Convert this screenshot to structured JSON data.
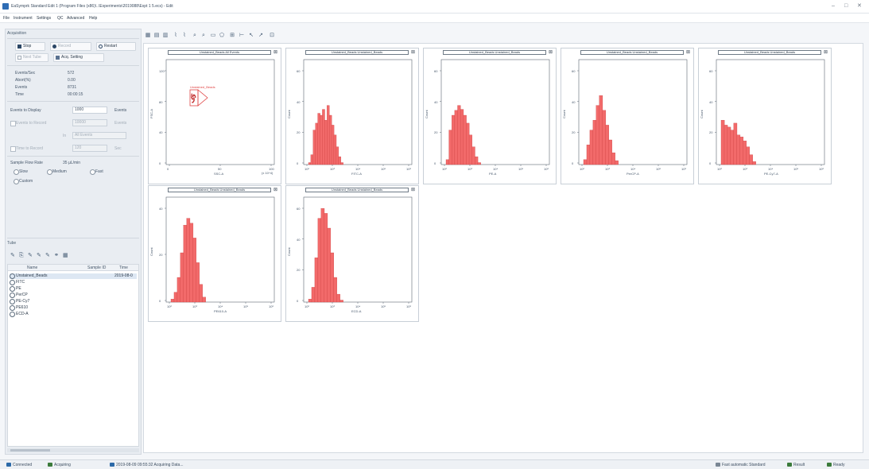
{
  "window": {
    "title": "EaSymprk Standard Edit 1 (Program Files (x86)\\..\\Experiments\\2019088\\Expt 1 5.ecs) - Edit",
    "controls": [
      "–",
      "□",
      "✕"
    ]
  },
  "menu": [
    "File",
    "Instrument",
    "Settings",
    "QC",
    "Advanced",
    "Help"
  ],
  "acquisition": {
    "header": "Acquisition",
    "buttons": {
      "stop": "Stop",
      "record": "Record",
      "restart": "Restart",
      "next_tube": "Next Tube",
      "acq_setting": "Acq. Setting"
    },
    "stats": [
      {
        "label": "Events/Sec",
        "value": "572"
      },
      {
        "label": "Abort(%)",
        "value": "0.00"
      },
      {
        "label": "Events",
        "value": "8731"
      },
      {
        "label": "Time",
        "value": "00:00:15"
      }
    ],
    "events_to_display": {
      "label": "Events to Display",
      "value": "1000",
      "unit": "Events"
    },
    "stop_condition_events": {
      "label": "Events to Record",
      "value": "10000",
      "unit": "Events"
    },
    "stop_condition_gate": {
      "label": "In",
      "value": "All Events"
    },
    "stop_condition_time": {
      "label": "Time to Record",
      "value": "120",
      "unit": "Sec"
    },
    "flow_rate": {
      "label": "Sample Flow Rate",
      "value": "35 µL/min",
      "options": [
        "Slow",
        "Medium",
        "Fast",
        "Custom"
      ]
    }
  },
  "tube": {
    "header": "Tube",
    "columns": [
      "Name",
      "Sample ID",
      "Time"
    ],
    "rows": [
      {
        "name": "Unstained_Beads",
        "time": "2019-08-0"
      },
      {
        "name": "FITC",
        "time": ""
      },
      {
        "name": "PE",
        "time": ""
      },
      {
        "name": "PerCP",
        "time": ""
      },
      {
        "name": "PE-Cy7",
        "time": ""
      },
      {
        "name": "PE610",
        "time": ""
      },
      {
        "name": "ECD-A",
        "time": ""
      }
    ]
  },
  "toolbar_icons": [
    "grid-icon",
    "layout-icon",
    "stats-icon",
    "line-icon",
    "zoom-in-icon",
    "zoom-out-icon",
    "rect-gate-icon",
    "poly-gate-icon",
    "quad-gate-icon",
    "hist-gate-icon",
    "pointer-icon",
    "arrow-icon",
    "fit-icon"
  ],
  "plots": [
    {
      "title": "Unstained_Beads  All Events",
      "type": "scatter",
      "x_label": "SSC-A",
      "y_label": "FSC-A",
      "x_ticks": [
        "0",
        "50",
        "100"
      ],
      "x_mult": "(x 10^4)",
      "y_ticks": [
        "0",
        "40",
        "80",
        "120"
      ],
      "gate": "Unstained_Beads"
    },
    {
      "title": "Unstained_Beads  Unstained_Beads",
      "type": "hist",
      "x_label": "FITC-A",
      "y_label": "Count",
      "x_ticks": [
        "10²",
        "10³",
        "10⁴",
        "10⁵",
        "10⁶"
      ],
      "y_ticks": [
        "0",
        "20",
        "40",
        "60"
      ],
      "heights": [
        0.02,
        0.1,
        0.35,
        0.42,
        0.52,
        0.5,
        0.56,
        0.45,
        0.6,
        0.5,
        0.4,
        0.3,
        0.18,
        0.08,
        0.02
      ]
    },
    {
      "title": "Unstained_Beads  Unstained_Beads",
      "type": "hist",
      "x_label": "PE-A",
      "y_label": "Count",
      "x_ticks": [
        "10²",
        "10³",
        "10⁴",
        "10⁵",
        "10⁶"
      ],
      "y_ticks": [
        "0",
        "20",
        "40",
        "60"
      ],
      "heights": [
        0.05,
        0.35,
        0.5,
        0.55,
        0.6,
        0.56,
        0.5,
        0.42,
        0.3,
        0.18,
        0.08,
        0.02
      ]
    },
    {
      "title": "Unstained_Beads  Unstained_Beads",
      "type": "hist",
      "x_label": "PerCP-A",
      "y_label": "Count",
      "x_ticks": [
        "10²",
        "10³",
        "10⁴",
        "10⁵",
        "10⁶"
      ],
      "y_ticks": [
        "0",
        "20",
        "40",
        "60"
      ],
      "heights": [
        0.05,
        0.2,
        0.35,
        0.45,
        0.6,
        0.7,
        0.55,
        0.4,
        0.25,
        0.12,
        0.04
      ]
    },
    {
      "title": "Unstained_Beads  Unstained_Beads",
      "type": "hist",
      "x_label": "PE-Cy7-A",
      "y_label": "Count",
      "x_ticks": [
        "10²",
        "10³",
        "10⁴",
        "10⁵",
        "10⁶"
      ],
      "y_ticks": [
        "0",
        "20",
        "40",
        "60"
      ],
      "heights": [
        0.45,
        0.4,
        0.38,
        0.35,
        0.42,
        0.3,
        0.28,
        0.24,
        0.18,
        0.1,
        0.03
      ]
    },
    {
      "title": "Unstained_Beads  Unstained_Beads",
      "type": "hist",
      "x_label": "PE610-A",
      "y_label": "Count",
      "x_ticks": [
        "10²",
        "10³",
        "10⁴",
        "10⁵",
        "10⁶"
      ],
      "y_ticks": [
        "0",
        "20",
        "40"
      ],
      "heights": [
        0.03,
        0.1,
        0.25,
        0.5,
        0.78,
        0.85,
        0.8,
        0.65,
        0.4,
        0.18,
        0.05
      ]
    },
    {
      "title": "Unstained_Beads  Unstained_Beads",
      "type": "hist",
      "x_label": "ECD-A",
      "y_label": "Count",
      "x_ticks": [
        "10²",
        "10³",
        "10⁴",
        "10⁵",
        "10⁶"
      ],
      "y_ticks": [
        "0",
        "20",
        "40",
        "60"
      ],
      "heights": [
        0.03,
        0.15,
        0.45,
        0.85,
        0.95,
        0.9,
        0.75,
        0.5,
        0.25,
        0.08,
        0.02
      ]
    }
  ],
  "status": {
    "connected": "Connected",
    "acquiring": "Acquiring",
    "message": "2019-08-09 09:55:32 Acquiring Data...",
    "right1": "Fast automatic Standard",
    "right2": "Result",
    "right3": "Ready"
  },
  "colors": {
    "histogram": "#f26a6a",
    "histogram_edge": "#c73a3a",
    "gate": "#e04545"
  }
}
